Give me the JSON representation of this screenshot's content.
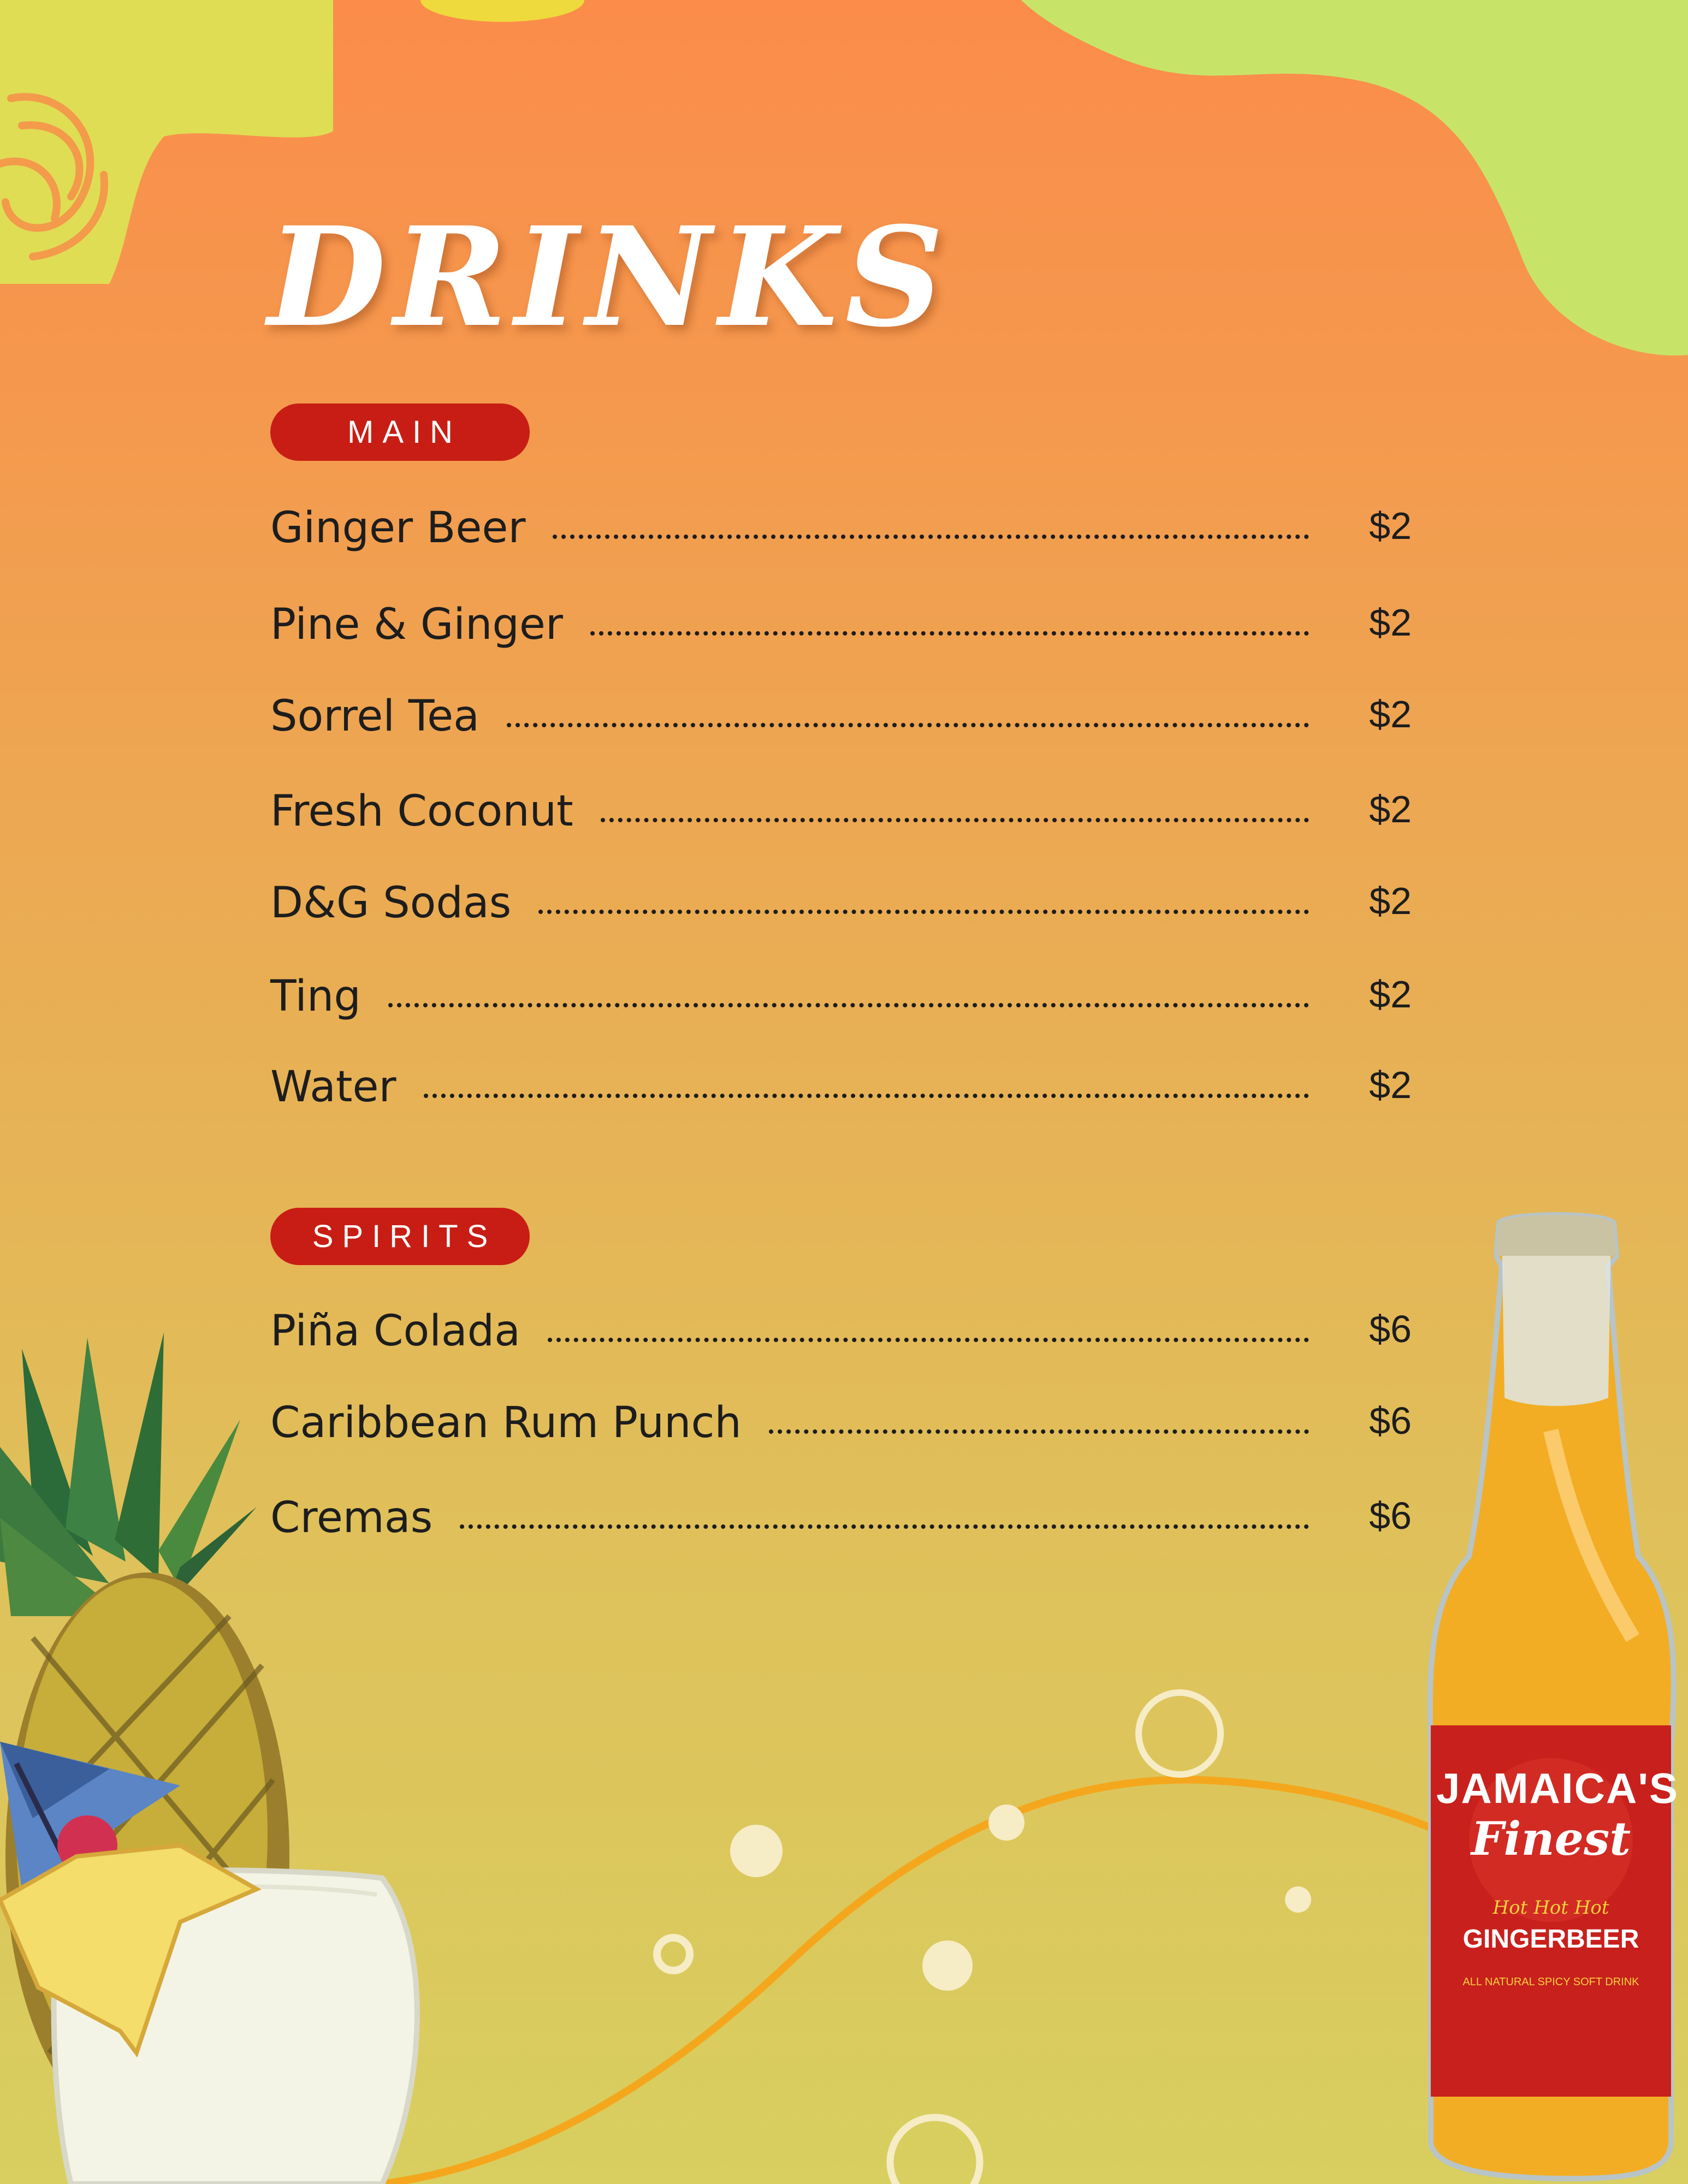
{
  "menu": {
    "title": "DRINKS",
    "sections": [
      {
        "label": "MAIN",
        "items": [
          {
            "name": "Ginger Beer",
            "price": "$2"
          },
          {
            "name": "Pine & Ginger",
            "price": "$2"
          },
          {
            "name": "Sorrel Tea",
            "price": "$2"
          },
          {
            "name": "Fresh Coconut",
            "price": "$2"
          },
          {
            "name": "D&G Sodas",
            "price": "$2"
          },
          {
            "name": "Ting",
            "price": "$2"
          },
          {
            "name": "Water",
            "price": "$2"
          }
        ]
      },
      {
        "label": "SPIRITS",
        "items": [
          {
            "name": "Piña Colada",
            "price": "$6"
          },
          {
            "name": "Caribbean Rum Punch",
            "price": "$6"
          },
          {
            "name": "Cremas",
            "price": "$6"
          }
        ]
      }
    ]
  },
  "bottle_label": {
    "brand_line1": "JAMAICA'S",
    "brand_line2": "Finest",
    "tagline": "Hot Hot Hot",
    "product": "GINGERBEER",
    "subtitle": "ALL NATURAL SPICY SOFT DRINK"
  },
  "colors": {
    "pill": "#c81d14",
    "title": "#ffffff",
    "text": "#1d1d1d",
    "lime_blob": "#c8e468",
    "label_red": "#c8201c"
  },
  "icons": [
    "pineapple-illustration",
    "cocktail-umbrella-icon",
    "ginger-beer-bottle-illustration",
    "bubble-icons",
    "wave-line"
  ]
}
